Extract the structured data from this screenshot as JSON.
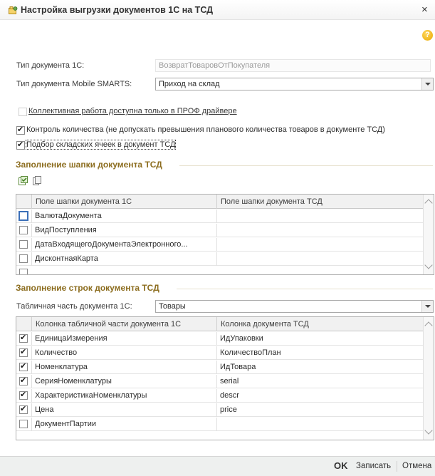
{
  "window": {
    "title": "Настройка выгрузки документов 1С на ТСД",
    "close": "×",
    "help": "?"
  },
  "form": {
    "doc_type_1c_label": "Тип документа 1С:",
    "doc_type_1c_value": "ВозвратТоваровОтПокупателя",
    "doc_type_ms_label": "Тип документа Mobile SMARTS:",
    "doc_type_ms_value": "Приход на склад",
    "collective_label": "Коллективная работа доступна только в ПРОФ драйвере",
    "qty_control_label": "Контроль количества (не допускать превышения планового количества товаров в документе ТСД)",
    "cells_label": "Подбор складских ячеек в документ ТСД"
  },
  "header_section": {
    "title": "Заполнение шапки документа ТСД",
    "columns": [
      "Поле шапки документа 1С",
      "Поле шапки документа ТСД"
    ],
    "rows": [
      {
        "field_1c": "ВалютаДокумента",
        "field_tsd": ""
      },
      {
        "field_1c": "ВидПоступления",
        "field_tsd": ""
      },
      {
        "field_1c": "ДатаВходящегоДокументаЭлектронного...",
        "field_tsd": ""
      },
      {
        "field_1c": "ДисконтнаяКарта",
        "field_tsd": ""
      }
    ]
  },
  "lines_section": {
    "title": "Заполнение строк документа ТСД",
    "tab_part_label": "Табличная часть документа 1С:",
    "tab_part_value": "Товары",
    "columns": [
      "Колонка табличной части документа 1С",
      "Колонка документа ТСД"
    ],
    "rows": [
      {
        "col_1c": "ЕдиницаИзмерения",
        "col_tsd": "ИдУпаковки"
      },
      {
        "col_1c": "Количество",
        "col_tsd": "КоличествоПлан"
      },
      {
        "col_1c": "Номенклатура",
        "col_tsd": "ИдТовара"
      },
      {
        "col_1c": "СерияНоменклатуры",
        "col_tsd": "serial"
      },
      {
        "col_1c": "ХарактеристикаНоменклатуры",
        "col_tsd": "descr"
      },
      {
        "col_1c": "Цена",
        "col_tsd": "price"
      },
      {
        "col_1c": "ДокументПартии",
        "col_tsd": ""
      }
    ]
  },
  "footer": {
    "ok": "OK",
    "save": "Записать",
    "cancel": "Отмена"
  }
}
